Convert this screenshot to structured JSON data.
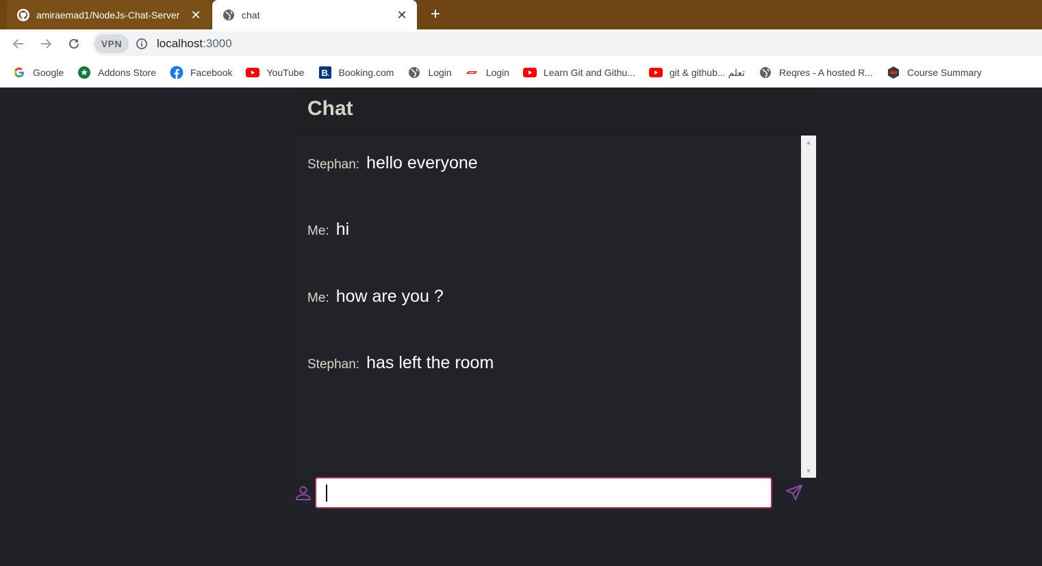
{
  "browser": {
    "tabs": [
      {
        "title": "amiraemad1/NodeJs-Chat-Server",
        "favicon": "github-icon",
        "active": false
      },
      {
        "title": "chat",
        "favicon": "globe-icon",
        "active": true
      }
    ],
    "new_tab_label": "+",
    "close_label": "✕",
    "omnibox": {
      "vpn_label": "VPN",
      "host": "localhost",
      "port": ":3000"
    },
    "bookmarks": [
      {
        "label": "Google",
        "icon": "google-icon"
      },
      {
        "label": "Addons Store",
        "icon": "addons-store-icon"
      },
      {
        "label": "Facebook",
        "icon": "facebook-icon"
      },
      {
        "label": "YouTube",
        "icon": "youtube-icon"
      },
      {
        "label": "Booking.com",
        "icon": "booking-icon"
      },
      {
        "label": "Login",
        "icon": "globe-icon"
      },
      {
        "label": "Login",
        "icon": "login-logo-icon"
      },
      {
        "label": "Learn Git and Githu...",
        "icon": "youtube-icon"
      },
      {
        "label": "git & github... تعلم",
        "icon": "youtube-icon"
      },
      {
        "label": "Reqres - A hosted R...",
        "icon": "globe-icon"
      },
      {
        "label": "Course Summary",
        "icon": "course-icon"
      }
    ]
  },
  "chat": {
    "title": "Chat",
    "messages": [
      {
        "sender": "Stephan:",
        "text": "hello everyone"
      },
      {
        "sender": "Me:",
        "text": "hi"
      },
      {
        "sender": "Me:",
        "text": "how are you ?"
      },
      {
        "sender": "Stephan:",
        "text": "has left the room"
      }
    ],
    "input": {
      "value": "",
      "placeholder": ""
    }
  },
  "colors": {
    "tabstrip": "#6d4613",
    "page_background": "#202228",
    "accent_purple": "#8b4aa6",
    "input_border": "#b52a4a"
  }
}
